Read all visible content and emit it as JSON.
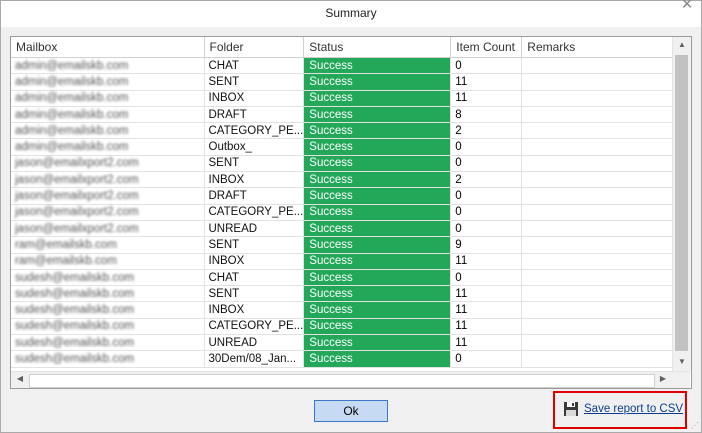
{
  "window": {
    "title": "Summary",
    "close_glyph": "✕"
  },
  "grid": {
    "columns": [
      "Mailbox",
      "Folder",
      "Status",
      "Item Count",
      "Remarks"
    ],
    "rows": [
      {
        "mailbox": "admin@emailskb.com",
        "folder": "CHAT",
        "status": "Success",
        "count": "0",
        "remarks": ""
      },
      {
        "mailbox": "admin@emailskb.com",
        "folder": "SENT",
        "status": "Success",
        "count": "11",
        "remarks": ""
      },
      {
        "mailbox": "admin@emailskb.com",
        "folder": "INBOX",
        "status": "Success",
        "count": "11",
        "remarks": ""
      },
      {
        "mailbox": "admin@emailskb.com",
        "folder": "DRAFT",
        "status": "Success",
        "count": "8",
        "remarks": ""
      },
      {
        "mailbox": "admin@emailskb.com",
        "folder": "CATEGORY_PE...",
        "status": "Success",
        "count": "2",
        "remarks": ""
      },
      {
        "mailbox": "admin@emailskb.com",
        "folder": "Outbox_",
        "status": "Success",
        "count": "0",
        "remarks": ""
      },
      {
        "mailbox": "jason@emailxport2.com",
        "folder": "SENT",
        "status": "Success",
        "count": "0",
        "remarks": ""
      },
      {
        "mailbox": "jason@emailxport2.com",
        "folder": "INBOX",
        "status": "Success",
        "count": "2",
        "remarks": ""
      },
      {
        "mailbox": "jason@emailxport2.com",
        "folder": "DRAFT",
        "status": "Success",
        "count": "0",
        "remarks": ""
      },
      {
        "mailbox": "jason@emailxport2.com",
        "folder": "CATEGORY_PE...",
        "status": "Success",
        "count": "0",
        "remarks": ""
      },
      {
        "mailbox": "jason@emailxport2.com",
        "folder": "UNREAD",
        "status": "Success",
        "count": "0",
        "remarks": ""
      },
      {
        "mailbox": "ram@emailskb.com",
        "folder": "SENT",
        "status": "Success",
        "count": "9",
        "remarks": ""
      },
      {
        "mailbox": "ram@emailskb.com",
        "folder": "INBOX",
        "status": "Success",
        "count": "11",
        "remarks": ""
      },
      {
        "mailbox": "sudesh@emailskb.com",
        "folder": "CHAT",
        "status": "Success",
        "count": "0",
        "remarks": ""
      },
      {
        "mailbox": "sudesh@emailskb.com",
        "folder": "SENT",
        "status": "Success",
        "count": "11",
        "remarks": ""
      },
      {
        "mailbox": "sudesh@emailskb.com",
        "folder": "INBOX",
        "status": "Success",
        "count": "11",
        "remarks": ""
      },
      {
        "mailbox": "sudesh@emailskb.com",
        "folder": "CATEGORY_PE...",
        "status": "Success",
        "count": "11",
        "remarks": ""
      },
      {
        "mailbox": "sudesh@emailskb.com",
        "folder": "UNREAD",
        "status": "Success",
        "count": "11",
        "remarks": ""
      },
      {
        "mailbox": "sudesh@emailskb.com",
        "folder": "30Dem/08_Jan...",
        "status": "Success",
        "count": "0",
        "remarks": ""
      }
    ]
  },
  "footer": {
    "ok_label": "Ok",
    "save_csv_label": "Save report to CSV"
  },
  "colors": {
    "status_success": "#23a859",
    "link": "#0d3d91",
    "highlight_box": "#e00000",
    "ok_button": "#c7daf4"
  },
  "icons": {
    "close": "close-icon",
    "save": "floppy-disk-icon"
  }
}
